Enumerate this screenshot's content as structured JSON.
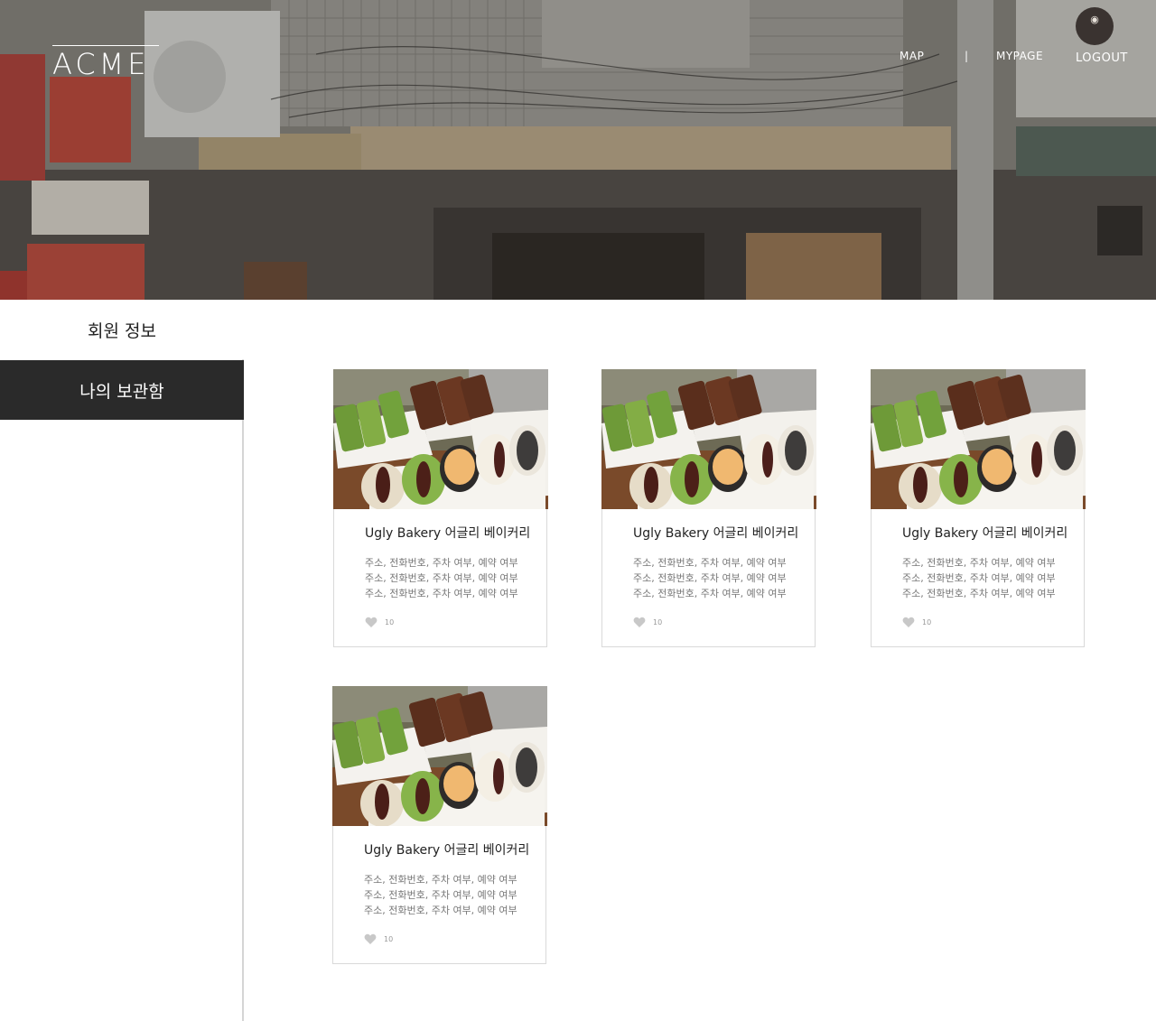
{
  "header": {
    "logo": "ACME",
    "nav": {
      "map": "MAP",
      "separator": "|",
      "mypage": "MYPAGE",
      "logout": "LOGOUT"
    }
  },
  "sidebar": {
    "items": [
      {
        "label": "회원 정보",
        "active": false
      },
      {
        "label": "나의 보관함",
        "active": true
      }
    ]
  },
  "cards": [
    {
      "title": "Ugly Bakery 어글리 베이커리",
      "desc": [
        "주소, 전화번호, 주차 여부, 예약 여부",
        "주소, 전화번호, 주차 여부, 예약 여부",
        "주소, 전화번호, 주차 여부, 예약 여부"
      ],
      "likes": "10",
      "icon": "heart-icon"
    },
    {
      "title": "Ugly Bakery 어글리 베이커리",
      "desc": [
        "주소, 전화번호, 주차 여부, 예약 여부",
        "주소, 전화번호, 주차 여부, 예약 여부",
        "주소, 전화번호, 주차 여부, 예약 여부"
      ],
      "likes": "10",
      "icon": "heart-icon"
    },
    {
      "title": "Ugly Bakery 어글리 베이커리",
      "desc": [
        "주소, 전화번호, 주차 여부, 예약 여부",
        "주소, 전화번호, 주차 여부, 예약 여부",
        "주소, 전화번호, 주차 여부, 예약 여부"
      ],
      "likes": "10",
      "icon": "heart-icon"
    },
    {
      "title": "Ugly Bakery 어글리 베이커리",
      "desc": [
        "주소, 전화번호, 주차 여부, 예약 여부",
        "주소, 전화번호, 주차 여부, 예약 여부",
        "주소, 전화번호, 주차 여부, 예약 여부"
      ],
      "likes": "10",
      "icon": "heart-icon"
    }
  ],
  "colors": {
    "sidebar_active_bg": "#2a2a2a",
    "sidebar_active_text": "#ffffff",
    "card_border": "#d9d9d9",
    "heart": "#c8c8c8"
  }
}
